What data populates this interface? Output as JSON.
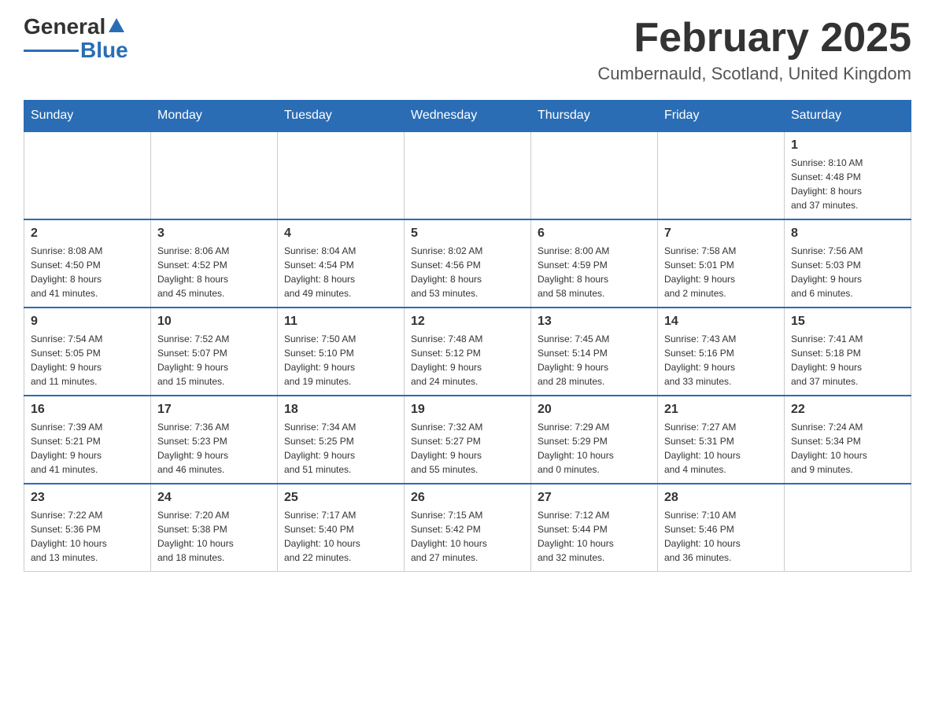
{
  "logo": {
    "text_main": "General",
    "text_blue": "Blue"
  },
  "header": {
    "title": "February 2025",
    "subtitle": "Cumbernauld, Scotland, United Kingdom"
  },
  "weekdays": [
    "Sunday",
    "Monday",
    "Tuesday",
    "Wednesday",
    "Thursday",
    "Friday",
    "Saturday"
  ],
  "weeks": [
    [
      {
        "day": "",
        "info": ""
      },
      {
        "day": "",
        "info": ""
      },
      {
        "day": "",
        "info": ""
      },
      {
        "day": "",
        "info": ""
      },
      {
        "day": "",
        "info": ""
      },
      {
        "day": "",
        "info": ""
      },
      {
        "day": "1",
        "info": "Sunrise: 8:10 AM\nSunset: 4:48 PM\nDaylight: 8 hours\nand 37 minutes."
      }
    ],
    [
      {
        "day": "2",
        "info": "Sunrise: 8:08 AM\nSunset: 4:50 PM\nDaylight: 8 hours\nand 41 minutes."
      },
      {
        "day": "3",
        "info": "Sunrise: 8:06 AM\nSunset: 4:52 PM\nDaylight: 8 hours\nand 45 minutes."
      },
      {
        "day": "4",
        "info": "Sunrise: 8:04 AM\nSunset: 4:54 PM\nDaylight: 8 hours\nand 49 minutes."
      },
      {
        "day": "5",
        "info": "Sunrise: 8:02 AM\nSunset: 4:56 PM\nDaylight: 8 hours\nand 53 minutes."
      },
      {
        "day": "6",
        "info": "Sunrise: 8:00 AM\nSunset: 4:59 PM\nDaylight: 8 hours\nand 58 minutes."
      },
      {
        "day": "7",
        "info": "Sunrise: 7:58 AM\nSunset: 5:01 PM\nDaylight: 9 hours\nand 2 minutes."
      },
      {
        "day": "8",
        "info": "Sunrise: 7:56 AM\nSunset: 5:03 PM\nDaylight: 9 hours\nand 6 minutes."
      }
    ],
    [
      {
        "day": "9",
        "info": "Sunrise: 7:54 AM\nSunset: 5:05 PM\nDaylight: 9 hours\nand 11 minutes."
      },
      {
        "day": "10",
        "info": "Sunrise: 7:52 AM\nSunset: 5:07 PM\nDaylight: 9 hours\nand 15 minutes."
      },
      {
        "day": "11",
        "info": "Sunrise: 7:50 AM\nSunset: 5:10 PM\nDaylight: 9 hours\nand 19 minutes."
      },
      {
        "day": "12",
        "info": "Sunrise: 7:48 AM\nSunset: 5:12 PM\nDaylight: 9 hours\nand 24 minutes."
      },
      {
        "day": "13",
        "info": "Sunrise: 7:45 AM\nSunset: 5:14 PM\nDaylight: 9 hours\nand 28 minutes."
      },
      {
        "day": "14",
        "info": "Sunrise: 7:43 AM\nSunset: 5:16 PM\nDaylight: 9 hours\nand 33 minutes."
      },
      {
        "day": "15",
        "info": "Sunrise: 7:41 AM\nSunset: 5:18 PM\nDaylight: 9 hours\nand 37 minutes."
      }
    ],
    [
      {
        "day": "16",
        "info": "Sunrise: 7:39 AM\nSunset: 5:21 PM\nDaylight: 9 hours\nand 41 minutes."
      },
      {
        "day": "17",
        "info": "Sunrise: 7:36 AM\nSunset: 5:23 PM\nDaylight: 9 hours\nand 46 minutes."
      },
      {
        "day": "18",
        "info": "Sunrise: 7:34 AM\nSunset: 5:25 PM\nDaylight: 9 hours\nand 51 minutes."
      },
      {
        "day": "19",
        "info": "Sunrise: 7:32 AM\nSunset: 5:27 PM\nDaylight: 9 hours\nand 55 minutes."
      },
      {
        "day": "20",
        "info": "Sunrise: 7:29 AM\nSunset: 5:29 PM\nDaylight: 10 hours\nand 0 minutes."
      },
      {
        "day": "21",
        "info": "Sunrise: 7:27 AM\nSunset: 5:31 PM\nDaylight: 10 hours\nand 4 minutes."
      },
      {
        "day": "22",
        "info": "Sunrise: 7:24 AM\nSunset: 5:34 PM\nDaylight: 10 hours\nand 9 minutes."
      }
    ],
    [
      {
        "day": "23",
        "info": "Sunrise: 7:22 AM\nSunset: 5:36 PM\nDaylight: 10 hours\nand 13 minutes."
      },
      {
        "day": "24",
        "info": "Sunrise: 7:20 AM\nSunset: 5:38 PM\nDaylight: 10 hours\nand 18 minutes."
      },
      {
        "day": "25",
        "info": "Sunrise: 7:17 AM\nSunset: 5:40 PM\nDaylight: 10 hours\nand 22 minutes."
      },
      {
        "day": "26",
        "info": "Sunrise: 7:15 AM\nSunset: 5:42 PM\nDaylight: 10 hours\nand 27 minutes."
      },
      {
        "day": "27",
        "info": "Sunrise: 7:12 AM\nSunset: 5:44 PM\nDaylight: 10 hours\nand 32 minutes."
      },
      {
        "day": "28",
        "info": "Sunrise: 7:10 AM\nSunset: 5:46 PM\nDaylight: 10 hours\nand 36 minutes."
      },
      {
        "day": "",
        "info": ""
      }
    ]
  ]
}
